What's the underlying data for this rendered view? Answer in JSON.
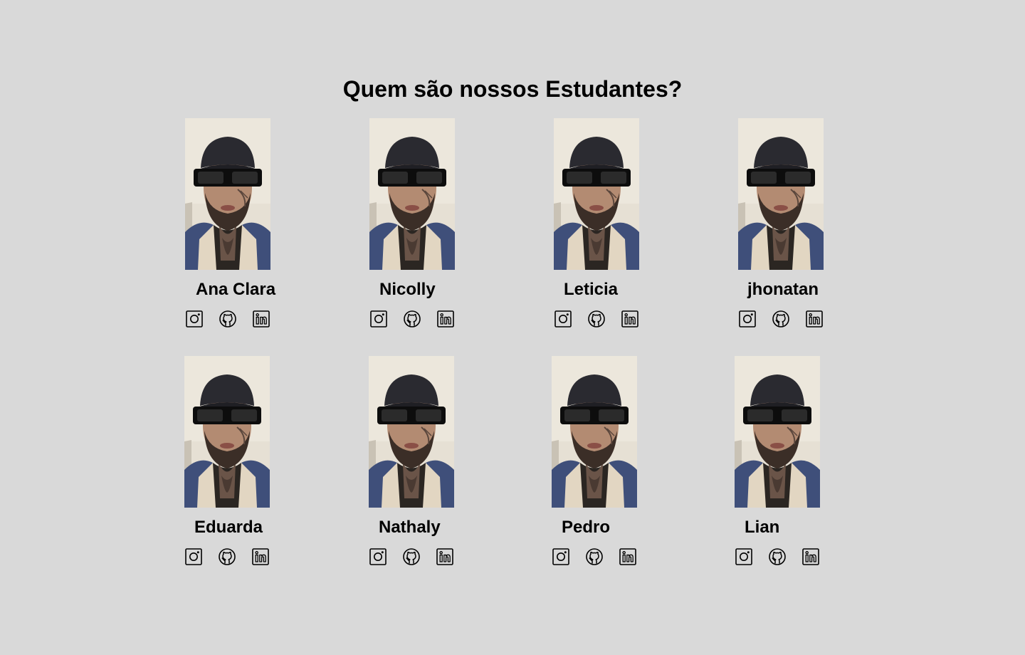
{
  "page": {
    "title": "Quem são nossos Estudantes?",
    "background": "#d9d9d9"
  },
  "icons": {
    "instagram": "instagram-icon",
    "github": "github-icon",
    "linkedin": "linkedin-icon"
  },
  "students": [
    {
      "name": "Ana Clara"
    },
    {
      "name": "Nicolly"
    },
    {
      "name": "Leticia"
    },
    {
      "name": "jhonatan"
    },
    {
      "name": "Eduarda"
    },
    {
      "name": "Nathaly"
    },
    {
      "name": "Pedro"
    },
    {
      "name": "Lian"
    }
  ]
}
